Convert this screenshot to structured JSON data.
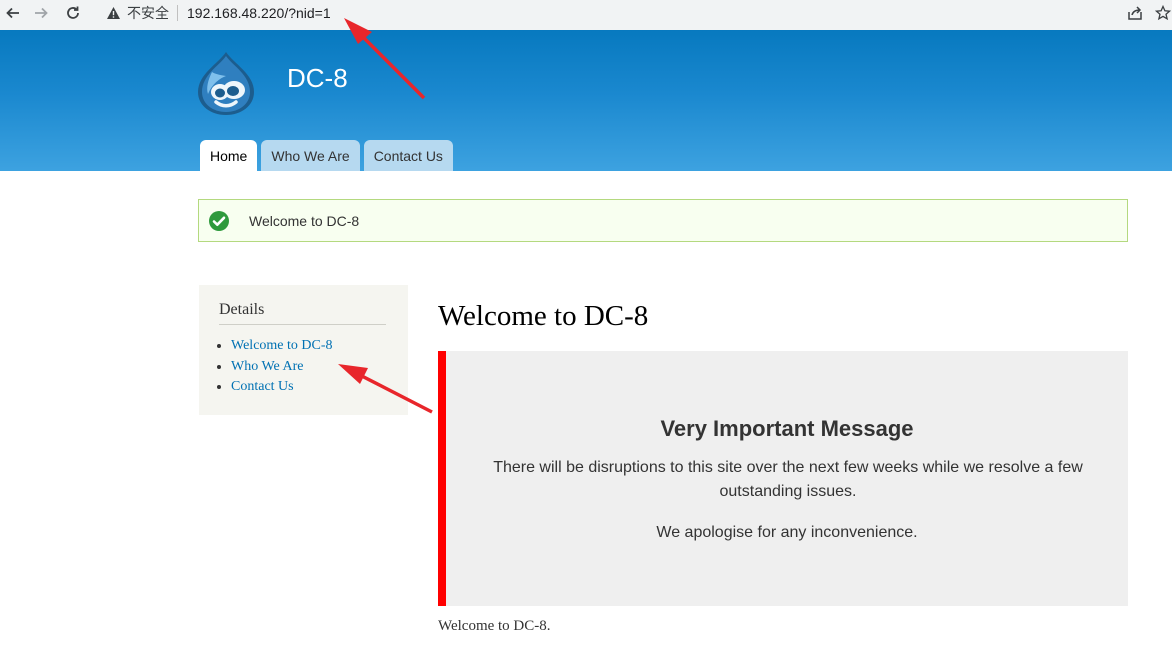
{
  "browser": {
    "security_label": "不安全",
    "url": "192.168.48.220/?nid=1",
    "icons": [
      "back-icon",
      "forward-icon",
      "reload-icon",
      "warning-icon",
      "share-icon",
      "star-icon"
    ]
  },
  "site": {
    "name": "DC-8",
    "logo": "drupal-drop-logo",
    "tabs": [
      {
        "label": "Home",
        "active": true
      },
      {
        "label": "Who We Are",
        "active": false
      },
      {
        "label": "Contact Us",
        "active": false
      }
    ]
  },
  "status": {
    "icon": "checkmark-circle-icon",
    "text": "Welcome to DC-8"
  },
  "sidebar": {
    "title": "Details",
    "links": [
      "Welcome to DC-8",
      "Who We Are",
      "Contact Us"
    ]
  },
  "main": {
    "title": "Welcome to DC-8",
    "message": {
      "heading": "Very Important Message",
      "paragraph1": "There will be disruptions to this site over the next few weeks while we resolve a few outstanding issues.",
      "paragraph2": "We apologise for any inconvenience."
    },
    "footer_text": "Welcome to DC-8."
  },
  "colors": {
    "header_top": "#0779bf",
    "header_bottom": "#3da2e0",
    "accent_bar": "#ff0000",
    "link": "#0071b3",
    "annotation_arrow": "#e8262b"
  }
}
